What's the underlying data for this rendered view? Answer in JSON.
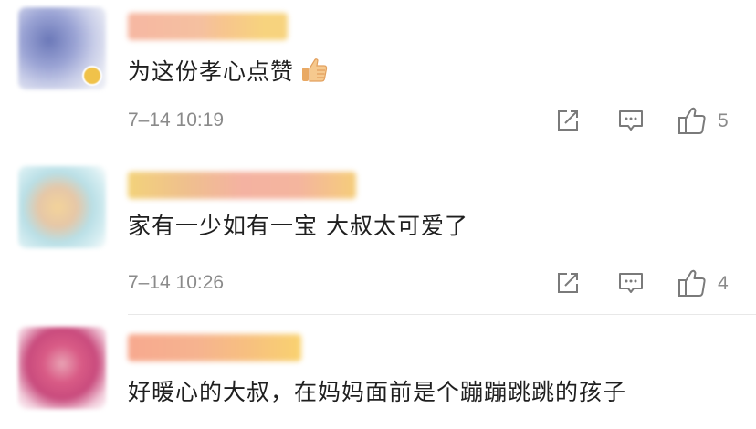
{
  "comments": [
    {
      "text": "为这份孝心点赞",
      "emoji": "thumbs-up-emoji",
      "time": "7–14 10:19",
      "likes": "5"
    },
    {
      "text": "家有一少如有一宝  大叔太可爱了",
      "time": "7–14 10:26",
      "likes": "4"
    },
    {
      "text": "好暖心的大叔，在妈妈面前是个蹦蹦跳跳的孩子"
    }
  ],
  "icons": {
    "share": "share-icon",
    "reply": "comment-icon",
    "like": "thumbs-up-outline-icon"
  },
  "colors": {
    "text": "#1f1f1f",
    "meta": "#8a8a8a",
    "divider": "#e8e8e8"
  }
}
